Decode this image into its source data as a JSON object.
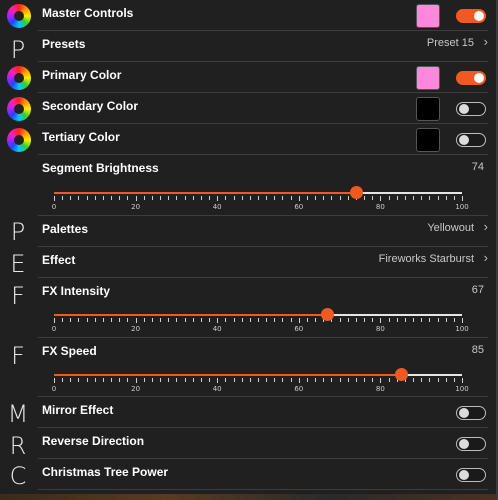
{
  "sidebar": {
    "letters": [
      "P",
      "P",
      "E",
      "F",
      "F",
      "M",
      "R",
      "C"
    ]
  },
  "rows": {
    "master_controls": {
      "label": "Master Controls",
      "swatch_color": "#ff88dd",
      "toggle": true
    },
    "presets": {
      "label": "Presets",
      "value": "Preset 15"
    },
    "primary_color": {
      "label": "Primary Color",
      "swatch_color": "#ff88dd",
      "toggle": true
    },
    "secondary_color": {
      "label": "Secondary Color",
      "swatch_color": "#000000",
      "toggle": false
    },
    "tertiary_color": {
      "label": "Tertiary Color",
      "swatch_color": "#000000",
      "toggle": false
    },
    "segment_brightness": {
      "label": "Segment Brightness",
      "value": "74",
      "level": 74
    },
    "palettes": {
      "label": "Palettes",
      "value": "Yellowout"
    },
    "effect": {
      "label": "Effect",
      "value": "Fireworks Starburst"
    },
    "fx_intensity": {
      "label": "FX Intensity",
      "value": "67",
      "level": 67
    },
    "fx_speed": {
      "label": "FX Speed",
      "value": "85",
      "level": 85
    },
    "mirror_effect": {
      "label": "Mirror Effect",
      "toggle": false
    },
    "reverse_direction": {
      "label": "Reverse Direction",
      "toggle": false
    },
    "christmas_tree_power": {
      "label": "Christmas Tree Power",
      "toggle": false
    }
  },
  "slider_scale": {
    "labels": [
      "0",
      "20",
      "40",
      "60",
      "80",
      "100"
    ],
    "min": 0,
    "max": 100
  },
  "colors": {
    "accent": "#f05a22",
    "background": "#202020",
    "divider": "#3d3d3d"
  },
  "icons": {
    "color_wheel": "color-wheel-icon",
    "chevron": "chevron-right-icon"
  }
}
